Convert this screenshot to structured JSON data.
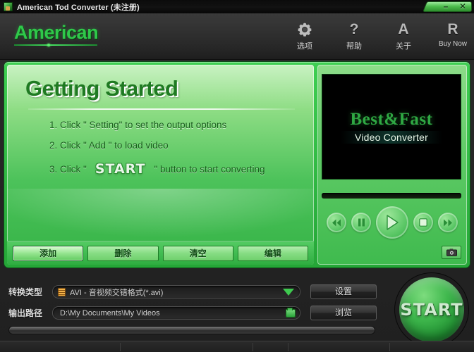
{
  "window": {
    "title": "American Tod Converter (未注册)",
    "icon": "app-icon",
    "minimize_label": "–",
    "close_label": "✕"
  },
  "header": {
    "brand": "American",
    "tools": [
      {
        "icon": "gear-icon",
        "label": "选项",
        "glyph": ""
      },
      {
        "icon": "question-icon",
        "label": "帮助",
        "glyph": "?"
      },
      {
        "icon": "about-icon",
        "label": "关于",
        "glyph": "A"
      },
      {
        "icon": "register-icon",
        "label": "Buy Now",
        "glyph": "R"
      }
    ]
  },
  "getting_started": {
    "title": "Getting Started",
    "steps": [
      {
        "prefix": "1. Click \" Setting\" to set the output options",
        "highlight": "",
        "suffix": ""
      },
      {
        "prefix": "2. Click \" Add \" to load video",
        "highlight": "",
        "suffix": ""
      },
      {
        "prefix": "3. Click \"",
        "highlight": "START",
        "suffix": "\" button to start converting"
      }
    ],
    "buttons": [
      {
        "label": "添加",
        "active": true
      },
      {
        "label": "删除",
        "active": false
      },
      {
        "label": "清空",
        "active": false
      },
      {
        "label": "编辑",
        "active": false
      }
    ]
  },
  "preview": {
    "video_title": "Best&Fast",
    "video_subtitle": "Video Converter",
    "transport": [
      {
        "name": "rewind-button"
      },
      {
        "name": "pause-button"
      },
      {
        "name": "play-button"
      },
      {
        "name": "stop-button"
      },
      {
        "name": "fast-forward-button"
      }
    ],
    "snapshot_icon": "camera-icon"
  },
  "options": {
    "format_label": "转换类型",
    "format_value": "AVI - 音视频交错格式(*.avi)",
    "settings_button": "设置",
    "path_label": "输出路径",
    "path_value": "D:\\My Documents\\My Videos",
    "browse_button": "浏览",
    "start_button": "START"
  },
  "colors": {
    "brand_green": "#2fc84a",
    "panel_green": "#4cc25a",
    "frame_green": "#3fcf52",
    "dark_bg": "#272727",
    "title_bg": "#0b0b0b"
  }
}
